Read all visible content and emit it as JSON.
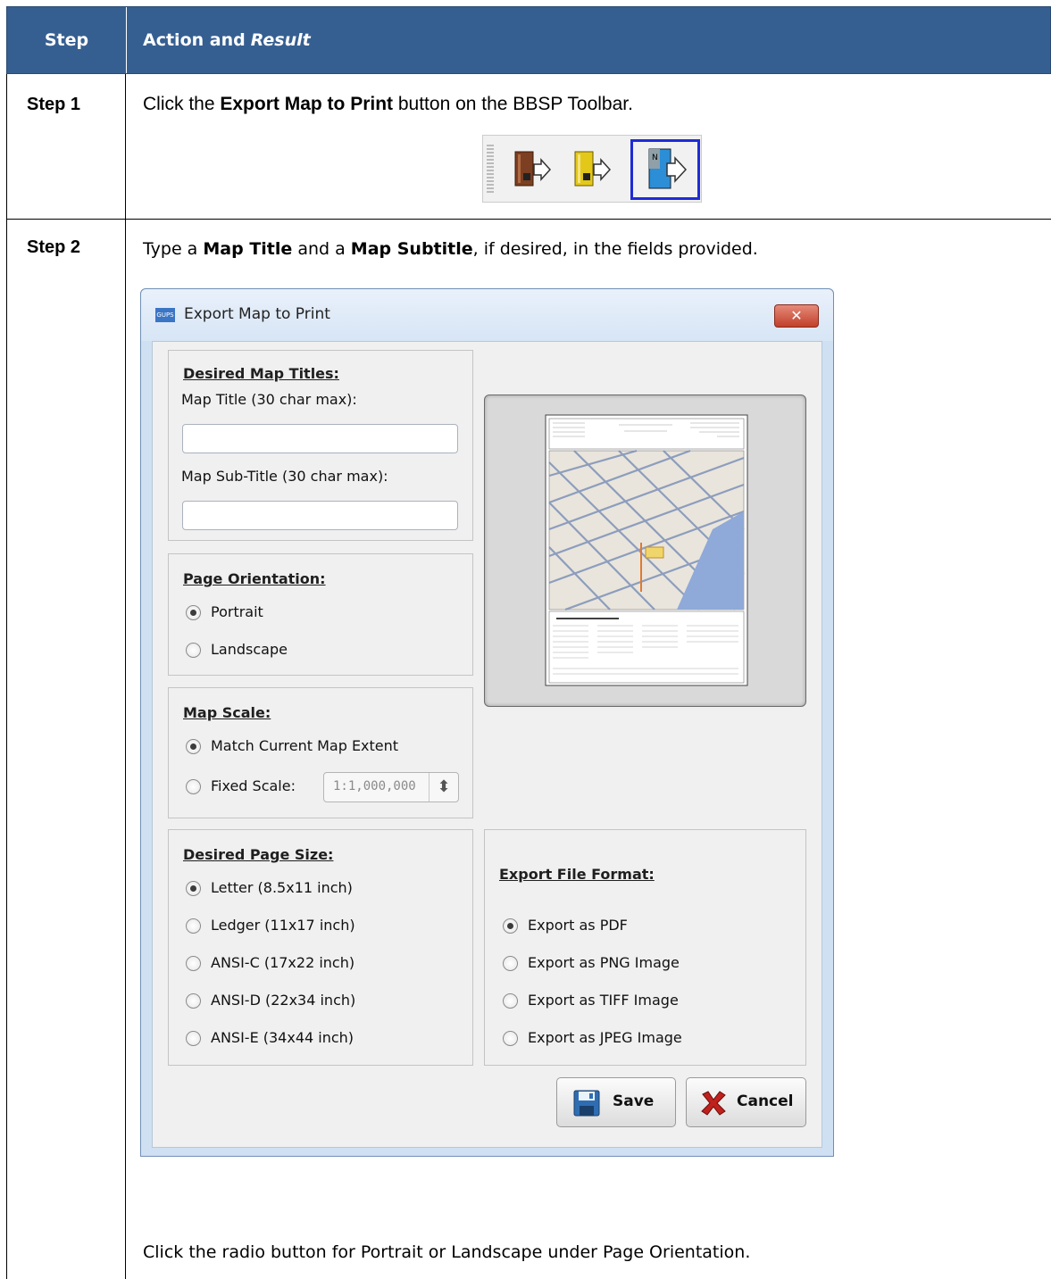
{
  "table": {
    "header_step": "Step",
    "header_action": "Action and",
    "header_result": "Result"
  },
  "step1": {
    "label": "Step 1",
    "text_before": "Click the ",
    "text_bold": "Export Map to Print",
    "text_after": " button on the BBSP Toolbar."
  },
  "step2": {
    "label": "Step 2",
    "t1": "Type a ",
    "b1": "Map Title",
    "t2": " and a ",
    "b2": "Map Subtitle",
    "t3": ", if desired, in the fields provided.",
    "after_text": "Click the radio button for Portrait or Landscape under Page Orientation."
  },
  "toolbar": {
    "icons": [
      "export-brown-icon",
      "export-yellow-icon",
      "export-map-to-print-icon"
    ],
    "colors": {
      "brown": "#8b4a2b",
      "yellow": "#e2c91e",
      "selected_border": "#1e2bd6"
    }
  },
  "dialog": {
    "logo_text": "GUPS",
    "title": "Export Map to Print",
    "close_label": "✕",
    "titles_group": {
      "heading": "Desired Map Titles:",
      "map_title_label": "Map Title (30 char max):",
      "map_title_value": "",
      "map_subtitle_label": "Map Sub-Title (30 char max):",
      "map_subtitle_value": ""
    },
    "orientation_group": {
      "heading": "Page Orientation:",
      "options": [
        "Portrait",
        "Landscape"
      ],
      "selected": "Portrait"
    },
    "scale_group": {
      "heading": "Map Scale:",
      "options": [
        "Match Current Map Extent",
        "Fixed Scale:"
      ],
      "selected": "Match Current Map Extent",
      "fixed_scale_value": "1:1,000,000",
      "spin_symbol": "⬍"
    },
    "page_size_group": {
      "heading": "Desired Page Size:",
      "options": [
        "Letter (8.5x11 inch)",
        "Ledger (11x17 inch)",
        "ANSI-C (17x22 inch)",
        "ANSI-D (22x34 inch)",
        "ANSI-E (34x44 inch)"
      ],
      "selected": "Letter (8.5x11 inch)"
    },
    "format_group": {
      "heading": "Export File Format:",
      "options": [
        "Export as PDF",
        "Export as PNG Image",
        "Export as TIFF Image",
        "Export as JPEG Image"
      ],
      "selected": "Export as PDF"
    },
    "buttons": {
      "save": "Save",
      "cancel": "Cancel"
    },
    "colors": {
      "title_bar": "#d7e5f5",
      "close": "#c1402a",
      "body": "#f0f0f0"
    }
  }
}
